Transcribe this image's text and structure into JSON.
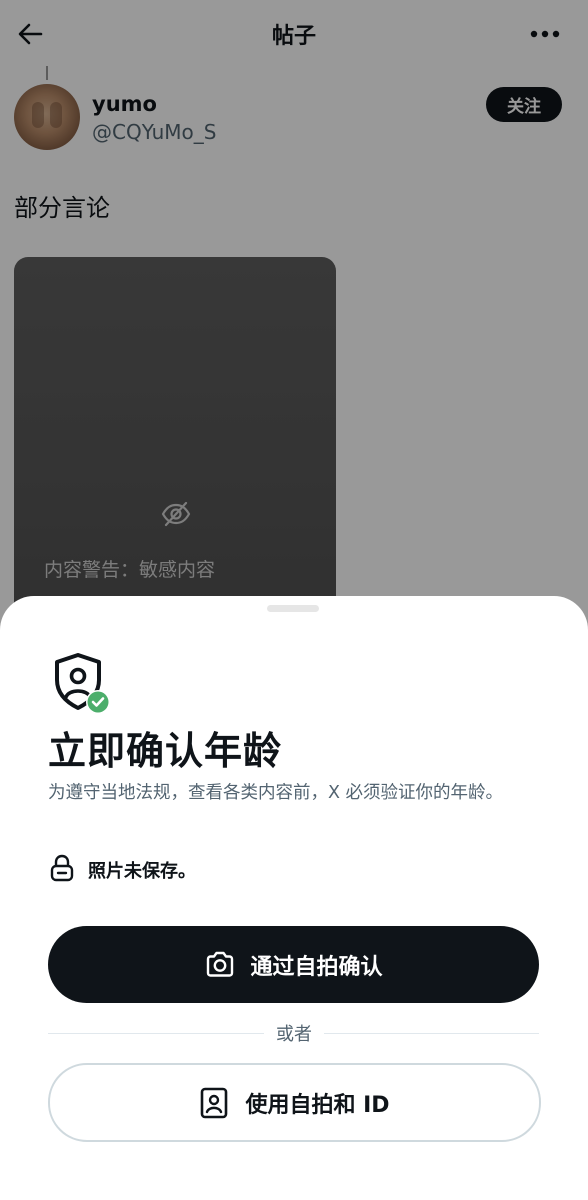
{
  "header": {
    "title": "帖子",
    "back_icon": "arrow-left-icon",
    "more_icon": "more-horizontal-icon"
  },
  "post": {
    "user_name": "yumo",
    "user_handle": "@CQYuMo_S",
    "follow_label": "关注",
    "text": "部分言论",
    "media_warning": "内容警告：敏感内容",
    "media_icon": "eye-off-icon"
  },
  "sheet": {
    "icon": "shield-user-check-icon",
    "title": "立即确认年龄",
    "description": "为遵守当地法规，查看各类内容前，X 必须验证你的年龄。",
    "privacy_note": "照片未保存。",
    "privacy_icon": "lock-icon",
    "primary_button": {
      "label": "通过自拍确认",
      "icon": "camera-icon"
    },
    "separator": "或者",
    "secondary_button": {
      "label": "使用自拍和 ID",
      "icon": "id-card-icon"
    }
  },
  "colors": {
    "text_primary": "#0f1419",
    "text_secondary": "#536471",
    "button_dark": "#0f1419",
    "check_badge": "#4cae6b",
    "overlay": "rgba(0,0,0,0.40)"
  }
}
